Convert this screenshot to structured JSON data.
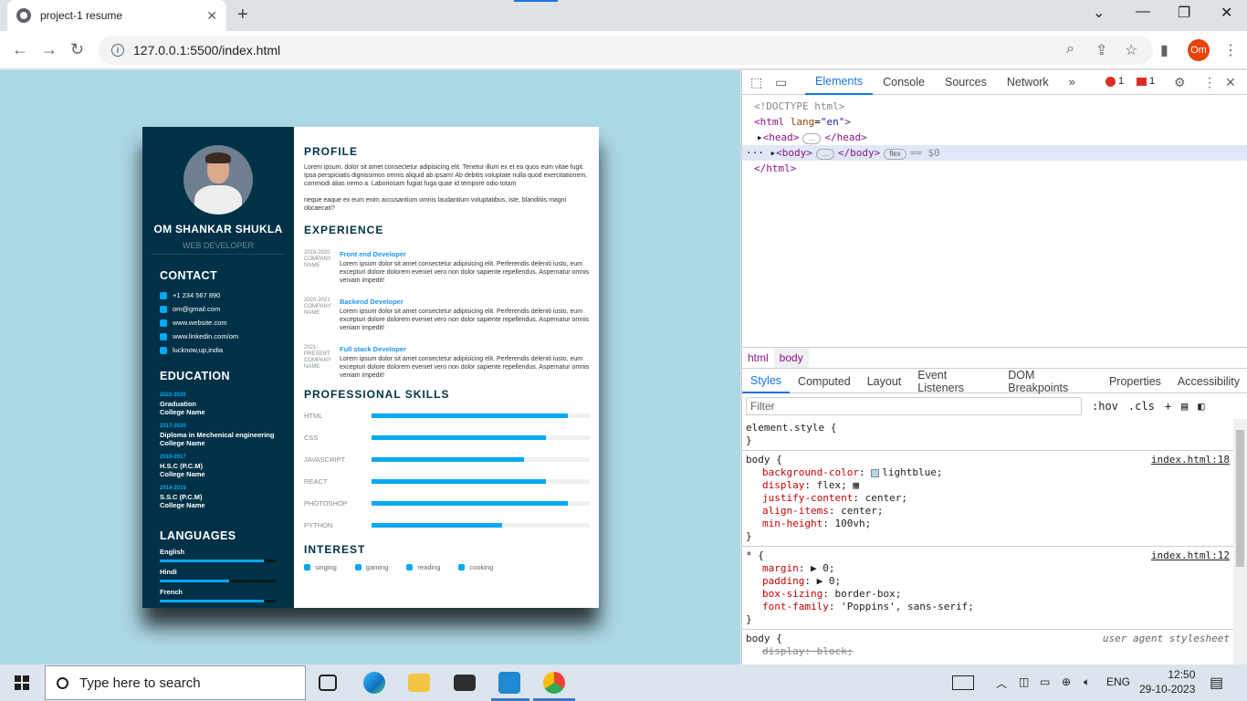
{
  "browser": {
    "tab_title": "project-1 resume",
    "url": "127.0.0.1:5500/index.html"
  },
  "resume": {
    "name": "OM SHANKAR SHUKLA",
    "role": "WEB DEVELOPER",
    "contact_heading": "CONTACT",
    "contacts": [
      {
        "icon": "phone-icon",
        "text": "+1 234 567 890"
      },
      {
        "icon": "mail-icon",
        "text": "om@gmail.com"
      },
      {
        "icon": "globe-icon",
        "text": "www.website.com"
      },
      {
        "icon": "linkedin-icon",
        "text": "www.linkedin.com/om"
      },
      {
        "icon": "location-icon",
        "text": "lucknow,up,india"
      }
    ],
    "education_heading": "EDUCATION",
    "education": [
      {
        "year": "2022-2026",
        "degree": "Graduation",
        "school": "College Name"
      },
      {
        "year": "2017-2020",
        "degree": "Diploma in Mechenical engineering",
        "school": "College Name"
      },
      {
        "year": "2016-2017",
        "degree": "H.S.C (P.C.M)",
        "school": "College Name"
      },
      {
        "year": "2014-2016",
        "degree": "S.S.C (P.C.M)",
        "school": "College Name"
      }
    ],
    "languages_heading": "LANGUAGES",
    "languages": [
      {
        "name": "English",
        "level": 0.9
      },
      {
        "name": "Hindi",
        "level": 0.6
      },
      {
        "name": "French",
        "level": 0.9
      }
    ],
    "profile_heading": "PROFILE",
    "profile_p1": "Lorem ipsum, dolor sit amet consectetur adipisicing elit. Tenetur illum ex et ea quos eum vitae fugit. Ipsa perspiciatis dignissimos omnis aliquid ab ipsam! Ab debitis voluptate nulla quod exercitationem, commodi alias nemo a. Laboriosam fugiat fuga quae id tempore odio totam",
    "profile_p2": "neque eaque ex eum enim accusantium omnis laudantium voluptatibus, iste, blanditiis magni obcaecati?",
    "experience_heading": "EXPERIENCE",
    "experience": [
      {
        "year": "2019-2020",
        "company": "COMPANY NAME",
        "title": "Front end Developer",
        "desc": "Lorem ipsum dolor sit amet consectetur adipisicing elit. Perferendis deleniti iusto, eum excepturi dolore dolorem eveniet vero non dolor sapiente repellendus. Aspernatur omnis veniam impedit!"
      },
      {
        "year": "2020-2021",
        "company": "COMPANY NAME",
        "title": "Backend Developer",
        "desc": "Lorem ipsum dolor sit amet consectetur adipisicing elit. Perferendis deleniti iusto, eum excepturi dolore dolorem eveniet vero non dolor sapiente repellendus. Aspernatur omnis veniam impedit!"
      },
      {
        "year": "2021-PRESENT",
        "company": "COMPANY NAME",
        "title": "Full stack Developer",
        "desc": "Lorem ipsum dolor sit amet consectetur adipisicing elit. Perferendis deleniti iusto, eum excepturi dolore dolorem eveniet vero non dolor sapiente repellendus. Aspernatur omnis veniam impedit!"
      }
    ],
    "skills_heading": "PROFESSIONAL SKILLS",
    "skills": [
      {
        "name": "HTML",
        "level": 0.9
      },
      {
        "name": "CSS",
        "level": 0.8
      },
      {
        "name": "JAVASCRIPT",
        "level": 0.7
      },
      {
        "name": "REACT",
        "level": 0.8
      },
      {
        "name": "PHOTOSHOP",
        "level": 0.9
      },
      {
        "name": "PYTHON",
        "level": 0.6
      }
    ],
    "interest_heading": "INTEREST",
    "interests": [
      {
        "icon": "mic-icon",
        "text": "singing"
      },
      {
        "icon": "gamepad-icon",
        "text": "gaming"
      },
      {
        "icon": "book-icon",
        "text": "reading"
      },
      {
        "icon": "utensils-icon",
        "text": "cooking"
      }
    ]
  },
  "devtools": {
    "tabs": [
      "Elements",
      "Console",
      "Sources",
      "Network"
    ],
    "error_count": "1",
    "issue_count": "1",
    "dom": {
      "doctype": "<!DOCTYPE html>",
      "html_open": "<html",
      "lang_attr": "lang",
      "lang_val": "\"en\"",
      "head": "<head>",
      "head_close": "</head>",
      "body": "<body>",
      "body_close": "</body>",
      "flex_pill": "flex",
      "eq": "== $0",
      "html_close": "</html>",
      "ellipsis": "…"
    },
    "crumbs": [
      "html",
      "body"
    ],
    "subtabs": [
      "Styles",
      "Computed",
      "Layout",
      "Event Listeners",
      "DOM Breakpoints",
      "Properties",
      "Accessibility"
    ],
    "filter_placeholder": "Filter",
    "hov": ":hov",
    "cls": ".cls",
    "styles": {
      "element_style": "element.style {",
      "close": "}",
      "body_sel": "body {",
      "body_src": "index.html:18",
      "body_decls": [
        {
          "prop": "background-color",
          "val": "lightblue;"
        },
        {
          "prop": "display",
          "val": "flex;"
        },
        {
          "prop": "justify-content",
          "val": "center;"
        },
        {
          "prop": "align-items",
          "val": "center;"
        },
        {
          "prop": "min-height",
          "val": "100vh;"
        }
      ],
      "star_sel": "* {",
      "star_src": "index.html:12",
      "star_decls": [
        {
          "prop": "margin",
          "val": "▶ 0;"
        },
        {
          "prop": "padding",
          "val": "▶ 0;"
        },
        {
          "prop": "box-sizing",
          "val": "border-box;"
        },
        {
          "prop": "font-family",
          "val": "'Poppins', sans-serif;"
        }
      ],
      "ua_sel": "body {",
      "ua_src": "user agent stylesheet",
      "ua_decl": "display: block;",
      "swatch_color": "#add8e6"
    }
  },
  "taskbar": {
    "search_placeholder": "Type here to search",
    "lang": "ENG",
    "time": "12:50",
    "date": "29-10-2023"
  }
}
